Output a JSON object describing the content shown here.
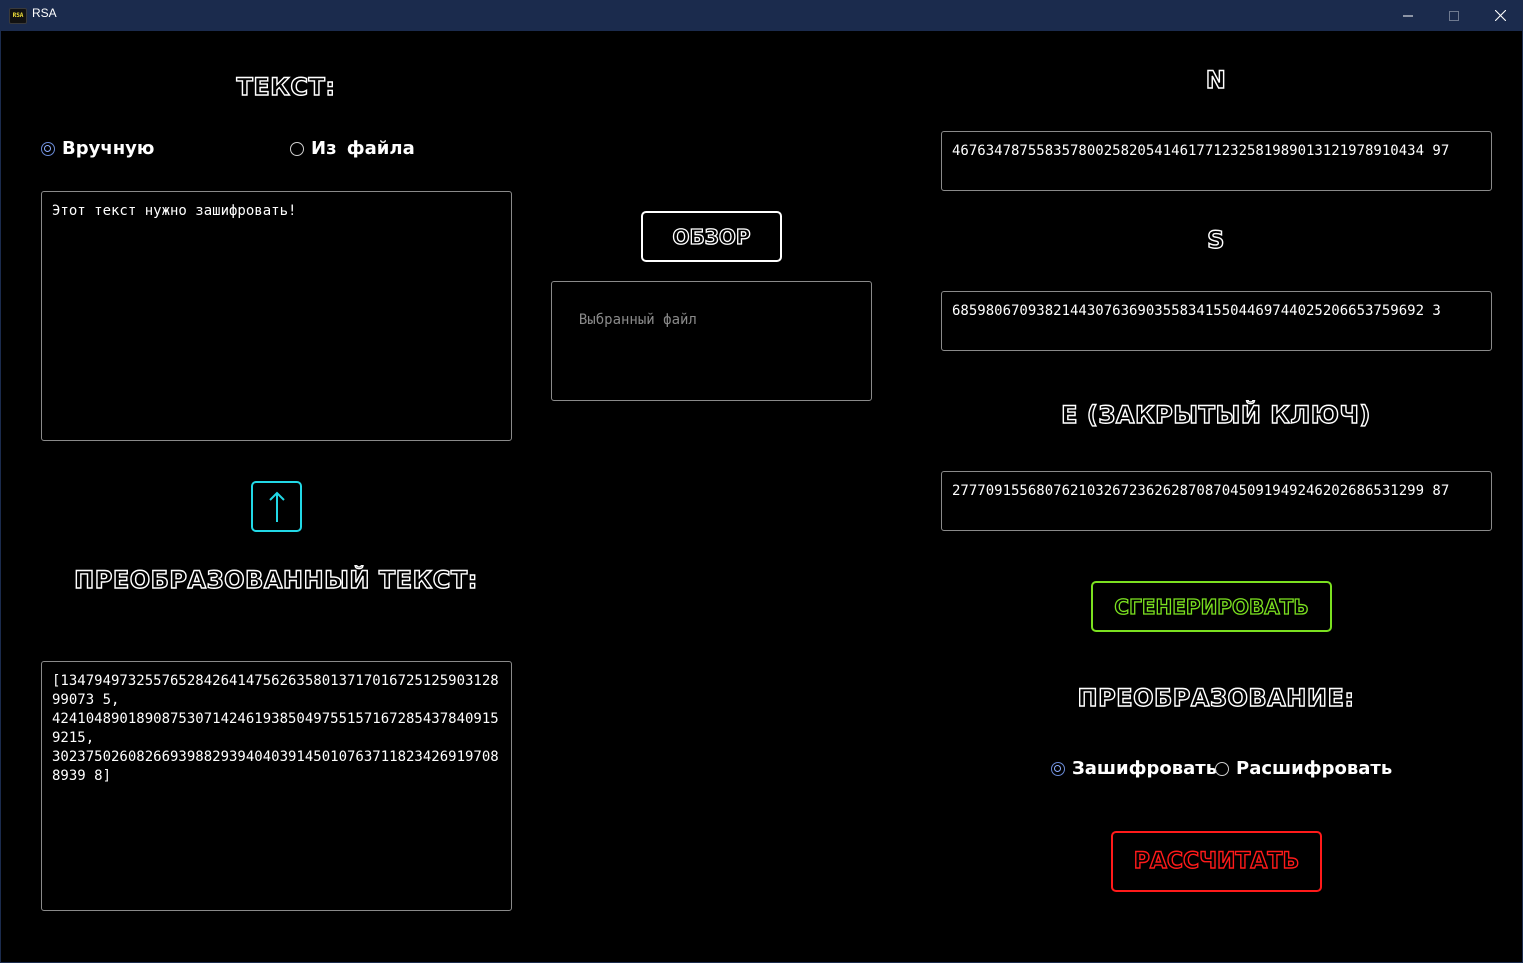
{
  "window": {
    "title": "RSA",
    "icon_text": "RSA"
  },
  "left": {
    "text_heading": "Текст:",
    "radio_manual": "Вручную",
    "radio_file": "Из файла",
    "input_text": "Этот текст нужно зашифровать!",
    "converted_heading": "Преобразованный текст:",
    "output_text": "[134794973255765284264147562635801371701672512590312899073 5,\n424104890189087530714246193850497551571672854378409159215,\n302375026082669398829394040391450107637118234269197088939 8]"
  },
  "middle": {
    "browse_label": "Обзор",
    "file_placeholder": "Выбранный файл"
  },
  "right": {
    "n_label": "N",
    "n_value": "46763478755835780025820541461771232581989013121978910434 97",
    "s_label": "S",
    "s_value": "68598067093821443076369035583415504469744025206653759692 3",
    "e_label": "Е (закрытый ключ)",
    "e_value": "27770915568076210326723626287087045091949246202686531299 87",
    "generate_label": "Сгенерировать",
    "transform_heading": "Преобразование:",
    "radio_encrypt": "Зашифровать",
    "radio_decrypt": "Расшифровать",
    "calc_label": "Рассчитать"
  },
  "colors": {
    "titlebar": "#1b2b4d",
    "generate": "#7be020",
    "calculate": "#ff1a1a",
    "arrow": "#22d8e6"
  },
  "icons": {
    "app": "rsa-app-icon",
    "minimize": "minimize-icon",
    "maximize": "maximize-icon",
    "close": "close-icon",
    "arrow": "arrow-up-icon"
  }
}
